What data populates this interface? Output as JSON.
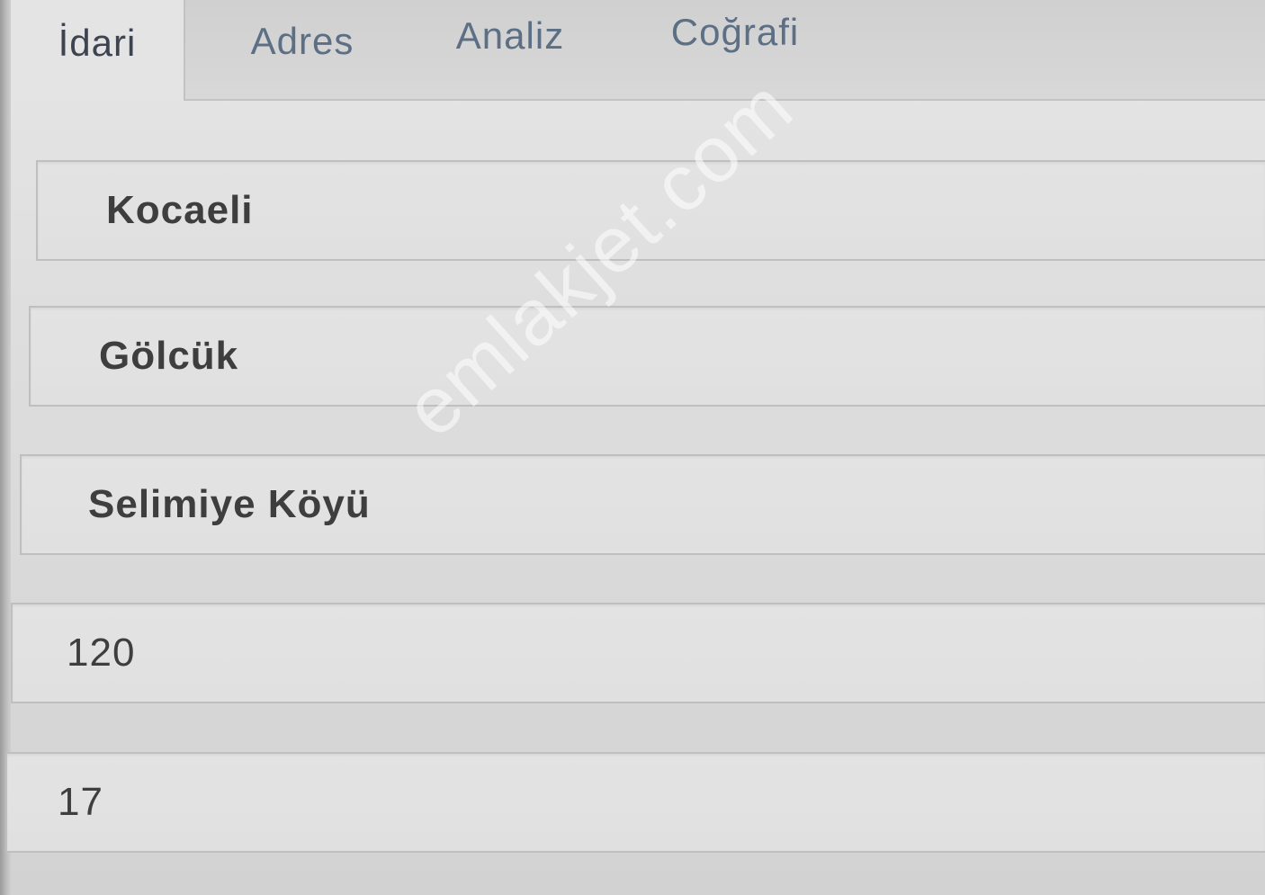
{
  "tabs": [
    {
      "label": "İdari",
      "active": true
    },
    {
      "label": "Adres",
      "active": false
    },
    {
      "label": "Analiz",
      "active": false
    },
    {
      "label": "Coğrafi",
      "active": false
    }
  ],
  "fields": [
    {
      "value": "Kocaeli"
    },
    {
      "value": "Gölcük"
    },
    {
      "value": "Selimiye Köyü"
    },
    {
      "value": "120"
    },
    {
      "value": "17"
    }
  ],
  "watermark": {
    "text": "emlakjet.com"
  },
  "colors": {
    "tab_text": "#5c6f85",
    "active_tab_text": "#3d4350",
    "field_text": "#3e3e3e",
    "background": "#dedede"
  }
}
